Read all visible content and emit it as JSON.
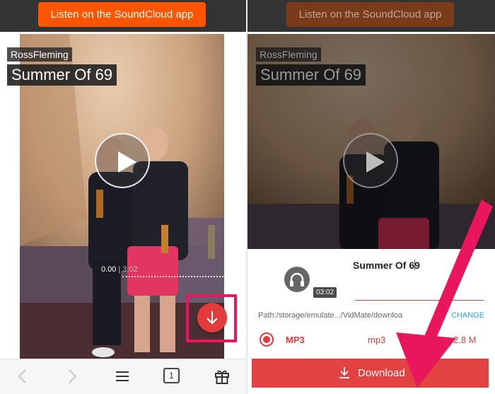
{
  "left": {
    "soundcloud_button": "Listen on the SoundCloud app",
    "artist": "RossFleming",
    "track_title": "Summer Of 69",
    "time_current": "0.00",
    "time_separator": "|",
    "time_duration": "3:02",
    "tab_count": "1",
    "icons": [
      "play-icon",
      "download-arrow-icon",
      "back-icon",
      "forward-icon",
      "menu-icon",
      "tabs-icon",
      "gift-icon"
    ]
  },
  "right": {
    "soundcloud_button": "Listen on the SoundCloud app",
    "artist": "RossFleming",
    "track_title": "Summer Of 69",
    "sheet_title": "Summer Of 69",
    "duration_badge": "03:02",
    "path": "Path:/storage/emulate.../VidMate/downloa",
    "change_label": "CHANGE",
    "format": {
      "name": "MP3",
      "ext": "mp3",
      "size": "2.8 M"
    },
    "download_label": "Download"
  },
  "colors": {
    "soundcloud_orange": "#ff5500",
    "accent_red": "#e24242",
    "highlight_pink": "#e8175d",
    "link_blue": "#27a5e0"
  }
}
